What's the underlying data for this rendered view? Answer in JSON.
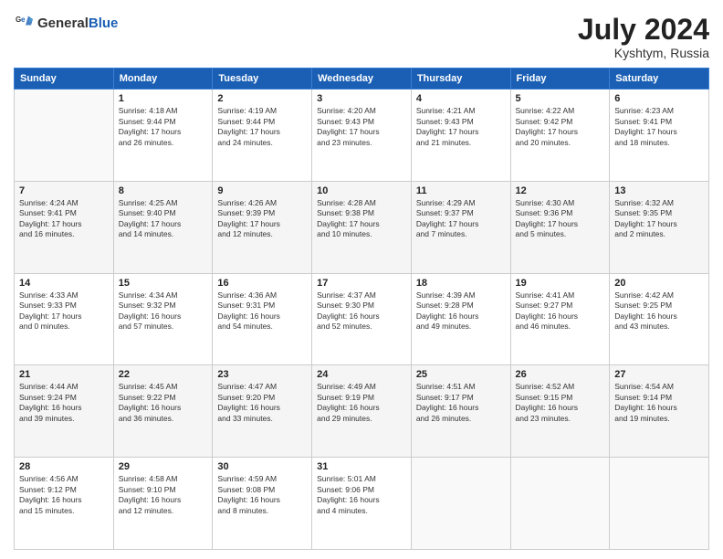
{
  "header": {
    "logo_general": "General",
    "logo_blue": "Blue",
    "month_year": "July 2024",
    "location": "Kyshtym, Russia"
  },
  "days_of_week": [
    "Sunday",
    "Monday",
    "Tuesday",
    "Wednesday",
    "Thursday",
    "Friday",
    "Saturday"
  ],
  "weeks": [
    [
      {
        "day": "",
        "info": ""
      },
      {
        "day": "1",
        "info": "Sunrise: 4:18 AM\nSunset: 9:44 PM\nDaylight: 17 hours\nand 26 minutes."
      },
      {
        "day": "2",
        "info": "Sunrise: 4:19 AM\nSunset: 9:44 PM\nDaylight: 17 hours\nand 24 minutes."
      },
      {
        "day": "3",
        "info": "Sunrise: 4:20 AM\nSunset: 9:43 PM\nDaylight: 17 hours\nand 23 minutes."
      },
      {
        "day": "4",
        "info": "Sunrise: 4:21 AM\nSunset: 9:43 PM\nDaylight: 17 hours\nand 21 minutes."
      },
      {
        "day": "5",
        "info": "Sunrise: 4:22 AM\nSunset: 9:42 PM\nDaylight: 17 hours\nand 20 minutes."
      },
      {
        "day": "6",
        "info": "Sunrise: 4:23 AM\nSunset: 9:41 PM\nDaylight: 17 hours\nand 18 minutes."
      }
    ],
    [
      {
        "day": "7",
        "info": "Sunrise: 4:24 AM\nSunset: 9:41 PM\nDaylight: 17 hours\nand 16 minutes."
      },
      {
        "day": "8",
        "info": "Sunrise: 4:25 AM\nSunset: 9:40 PM\nDaylight: 17 hours\nand 14 minutes."
      },
      {
        "day": "9",
        "info": "Sunrise: 4:26 AM\nSunset: 9:39 PM\nDaylight: 17 hours\nand 12 minutes."
      },
      {
        "day": "10",
        "info": "Sunrise: 4:28 AM\nSunset: 9:38 PM\nDaylight: 17 hours\nand 10 minutes."
      },
      {
        "day": "11",
        "info": "Sunrise: 4:29 AM\nSunset: 9:37 PM\nDaylight: 17 hours\nand 7 minutes."
      },
      {
        "day": "12",
        "info": "Sunrise: 4:30 AM\nSunset: 9:36 PM\nDaylight: 17 hours\nand 5 minutes."
      },
      {
        "day": "13",
        "info": "Sunrise: 4:32 AM\nSunset: 9:35 PM\nDaylight: 17 hours\nand 2 minutes."
      }
    ],
    [
      {
        "day": "14",
        "info": "Sunrise: 4:33 AM\nSunset: 9:33 PM\nDaylight: 17 hours\nand 0 minutes."
      },
      {
        "day": "15",
        "info": "Sunrise: 4:34 AM\nSunset: 9:32 PM\nDaylight: 16 hours\nand 57 minutes."
      },
      {
        "day": "16",
        "info": "Sunrise: 4:36 AM\nSunset: 9:31 PM\nDaylight: 16 hours\nand 54 minutes."
      },
      {
        "day": "17",
        "info": "Sunrise: 4:37 AM\nSunset: 9:30 PM\nDaylight: 16 hours\nand 52 minutes."
      },
      {
        "day": "18",
        "info": "Sunrise: 4:39 AM\nSunset: 9:28 PM\nDaylight: 16 hours\nand 49 minutes."
      },
      {
        "day": "19",
        "info": "Sunrise: 4:41 AM\nSunset: 9:27 PM\nDaylight: 16 hours\nand 46 minutes."
      },
      {
        "day": "20",
        "info": "Sunrise: 4:42 AM\nSunset: 9:25 PM\nDaylight: 16 hours\nand 43 minutes."
      }
    ],
    [
      {
        "day": "21",
        "info": "Sunrise: 4:44 AM\nSunset: 9:24 PM\nDaylight: 16 hours\nand 39 minutes."
      },
      {
        "day": "22",
        "info": "Sunrise: 4:45 AM\nSunset: 9:22 PM\nDaylight: 16 hours\nand 36 minutes."
      },
      {
        "day": "23",
        "info": "Sunrise: 4:47 AM\nSunset: 9:20 PM\nDaylight: 16 hours\nand 33 minutes."
      },
      {
        "day": "24",
        "info": "Sunrise: 4:49 AM\nSunset: 9:19 PM\nDaylight: 16 hours\nand 29 minutes."
      },
      {
        "day": "25",
        "info": "Sunrise: 4:51 AM\nSunset: 9:17 PM\nDaylight: 16 hours\nand 26 minutes."
      },
      {
        "day": "26",
        "info": "Sunrise: 4:52 AM\nSunset: 9:15 PM\nDaylight: 16 hours\nand 23 minutes."
      },
      {
        "day": "27",
        "info": "Sunrise: 4:54 AM\nSunset: 9:14 PM\nDaylight: 16 hours\nand 19 minutes."
      }
    ],
    [
      {
        "day": "28",
        "info": "Sunrise: 4:56 AM\nSunset: 9:12 PM\nDaylight: 16 hours\nand 15 minutes."
      },
      {
        "day": "29",
        "info": "Sunrise: 4:58 AM\nSunset: 9:10 PM\nDaylight: 16 hours\nand 12 minutes."
      },
      {
        "day": "30",
        "info": "Sunrise: 4:59 AM\nSunset: 9:08 PM\nDaylight: 16 hours\nand 8 minutes."
      },
      {
        "day": "31",
        "info": "Sunrise: 5:01 AM\nSunset: 9:06 PM\nDaylight: 16 hours\nand 4 minutes."
      },
      {
        "day": "",
        "info": ""
      },
      {
        "day": "",
        "info": ""
      },
      {
        "day": "",
        "info": ""
      }
    ]
  ]
}
